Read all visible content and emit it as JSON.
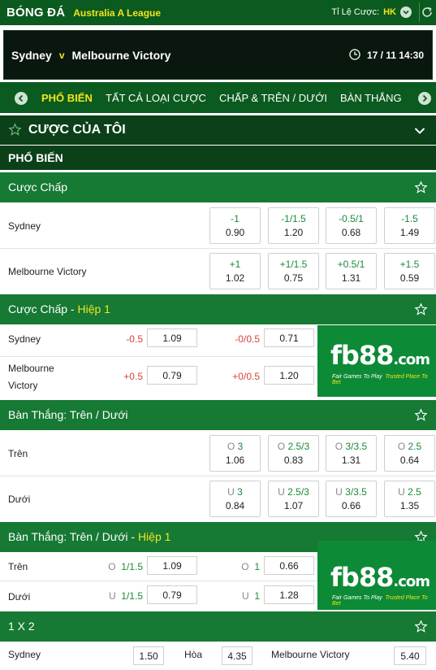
{
  "header": {
    "sport": "BÓNG ĐÁ",
    "league": "Australia A League",
    "odds_label": "Tỉ Lệ Cược:",
    "odds_type": "HK"
  },
  "match": {
    "home": "Sydney",
    "vs": "v",
    "away": "Melbourne Victory",
    "datetime": "17 / 11  14:30"
  },
  "tabs": [
    "PHỔ BIẾN",
    "TẤT CẢ LOẠI CƯỢC",
    "CHẤP & TRÊN / DƯỚI",
    "BÀN THẮNG"
  ],
  "my_bets": {
    "title": "CƯỢC CỦA TÔI"
  },
  "popular": {
    "title": "PHỔ BIẾN"
  },
  "handicap": {
    "title": "Cược Chấp",
    "rows": [
      {
        "team": "Sydney",
        "odds": [
          {
            "line": "-1",
            "price": "0.90"
          },
          {
            "line": "-1/1.5",
            "price": "1.20"
          },
          {
            "line": "-0.5/1",
            "price": "0.68"
          },
          {
            "line": "-1.5",
            "price": "1.49"
          }
        ]
      },
      {
        "team": "Melbourne Victory",
        "odds": [
          {
            "line": "+1",
            "price": "1.02"
          },
          {
            "line": "+1/1.5",
            "price": "0.75"
          },
          {
            "line": "+0.5/1",
            "price": "1.31"
          },
          {
            "line": "+1.5",
            "price": "0.59"
          }
        ]
      }
    ]
  },
  "handicap_h1": {
    "title": "Cược Chấp",
    "dash": " - ",
    "half": "Hiệp 1",
    "rows": [
      {
        "team": "Sydney",
        "odds": [
          {
            "line": "-0.5",
            "price": "1.09"
          },
          {
            "line": "-0/0.5",
            "price": "0.71"
          }
        ]
      },
      {
        "team_line1": "Melbourne",
        "team_line2": "Victory",
        "odds": [
          {
            "line": "+0.5",
            "price": "0.79"
          },
          {
            "line": "+0/0.5",
            "price": "1.20"
          }
        ]
      }
    ]
  },
  "over_under": {
    "title": "Bàn Thắng: Trên / Dưới",
    "rows": [
      {
        "label": "Trên",
        "prefix": "O",
        "odds": [
          {
            "line": "3",
            "price": "1.06"
          },
          {
            "line": "2.5/3",
            "price": "0.83"
          },
          {
            "line": "3/3.5",
            "price": "1.31"
          },
          {
            "line": "2.5",
            "price": "0.64"
          }
        ]
      },
      {
        "label": "Dưới",
        "prefix": "U",
        "odds": [
          {
            "line": "3",
            "price": "0.84"
          },
          {
            "line": "2.5/3",
            "price": "1.07"
          },
          {
            "line": "3/3.5",
            "price": "0.66"
          },
          {
            "line": "2.5",
            "price": "1.35"
          }
        ]
      }
    ]
  },
  "over_under_h1": {
    "title": "Bàn Thắng: Trên / Dưới",
    "dash": " - ",
    "half": "Hiệp 1",
    "rows": [
      {
        "label": "Trên",
        "prefix": "O",
        "odds": [
          {
            "line": "1/1.5",
            "price": "1.09"
          },
          {
            "line": "1",
            "price": "0.66"
          }
        ]
      },
      {
        "label": "Dưới",
        "prefix": "U",
        "odds": [
          {
            "line": "1/1.5",
            "price": "0.79"
          },
          {
            "line": "1",
            "price": "1.28"
          }
        ]
      }
    ]
  },
  "one_x_two": {
    "title": "1 X 2",
    "home": "Sydney",
    "home_price": "1.50",
    "draw": "Hòa",
    "draw_price": "4.35",
    "away": "Melbourne Victory",
    "away_price": "5.40"
  },
  "ad": {
    "brand": "fb88",
    "domain": ".com",
    "tag_a": "Fair Games To Play",
    "tag_b": "Trusted Place To Bet"
  },
  "colors": {
    "dark_green": "#0b5a1f",
    "section_green": "#167934",
    "accent_yellow": "#f3e51c",
    "positive": "#1a8a3a",
    "negative": "#d9413a"
  }
}
